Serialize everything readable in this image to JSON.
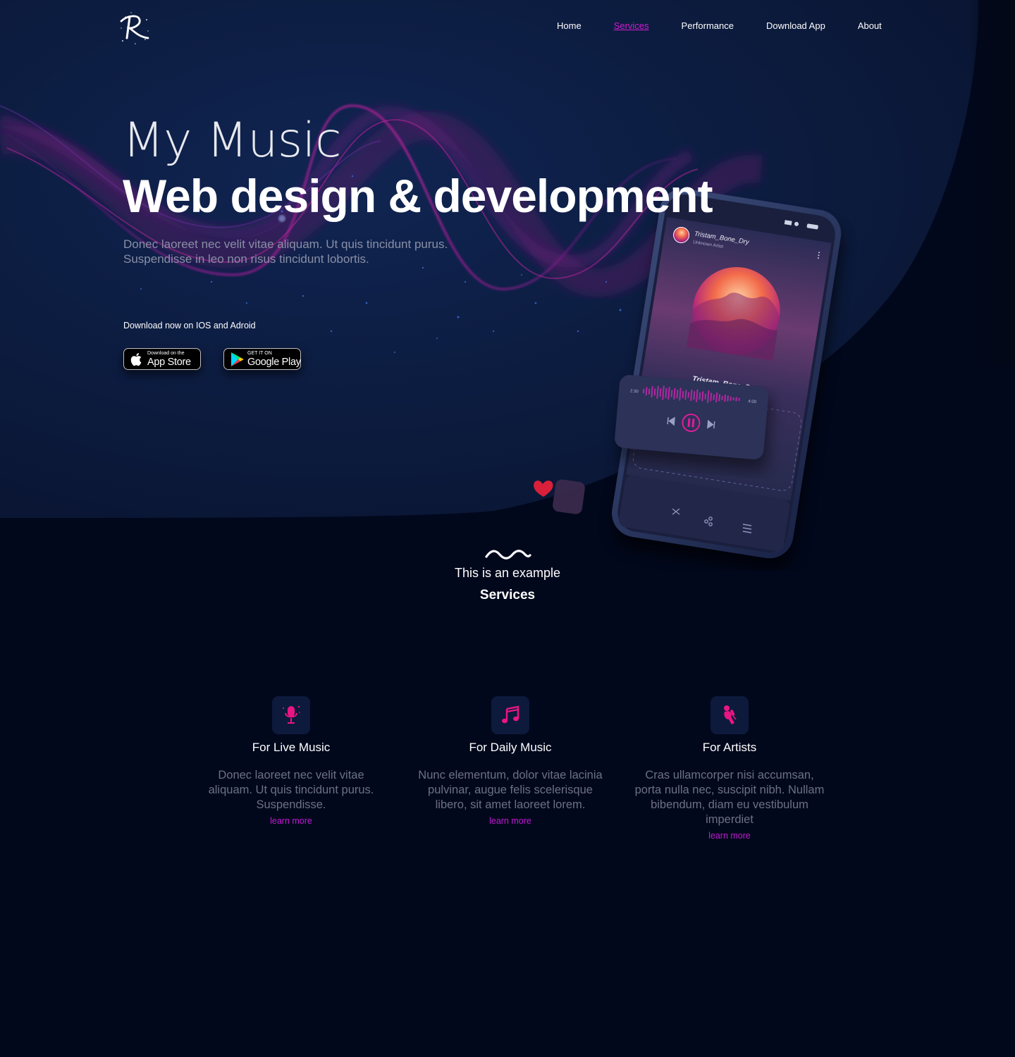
{
  "nav": {
    "items": [
      {
        "label": "Home",
        "active": false
      },
      {
        "label": "Services",
        "active": true
      },
      {
        "label": "Performance",
        "active": false
      },
      {
        "label": "Download App",
        "active": false
      },
      {
        "label": "About",
        "active": false
      }
    ],
    "logo_icon": "r-logo-icon"
  },
  "hero": {
    "subtitle": "My Music",
    "title": "Web design & development",
    "description": "Donec laoreet nec velit vitae aliquam. Ut quis tincidunt purus. Suspendisse in leo non risus tincidunt lobortis.",
    "download_label": "Download now on IOS and Adroid",
    "app_store": {
      "small": "Download on the",
      "big": "App Store"
    },
    "google_play": {
      "small": "GET IT ON",
      "big": "Google Play"
    }
  },
  "phone": {
    "track_name": "Tristam_Bone_Dry",
    "artist": "Unknown Artist",
    "elapsed": "2:30",
    "duration": "4:00"
  },
  "services": {
    "pre": "This is an example",
    "title": "Services",
    "cards": [
      {
        "icon": "microphone-icon",
        "title": "For Live Music",
        "desc": "Donec laoreet nec velit vitae aliquam. Ut quis tincidunt purus. Suspendisse.",
        "link": "learn more"
      },
      {
        "icon": "music-notes-icon",
        "title": "For Daily Music",
        "desc": "Nunc elementum, dolor vitae lacinia pulvinar, augue felis scelerisque libero, sit amet laoreet lorem.",
        "link": "learn more"
      },
      {
        "icon": "singer-icon",
        "title": "For Artists",
        "desc": "Cras ullamcorper nisi accumsan, porta nulla nec, suscipit nibh. Nullam bibendum, diam eu vestibulum imperdiet",
        "link": "learn more"
      }
    ]
  },
  "colors": {
    "accent": "#d21bd2",
    "hero_bg": "#0a1838",
    "page_bg": "#02081c",
    "card_icon_bg": "#0d1a3c"
  }
}
